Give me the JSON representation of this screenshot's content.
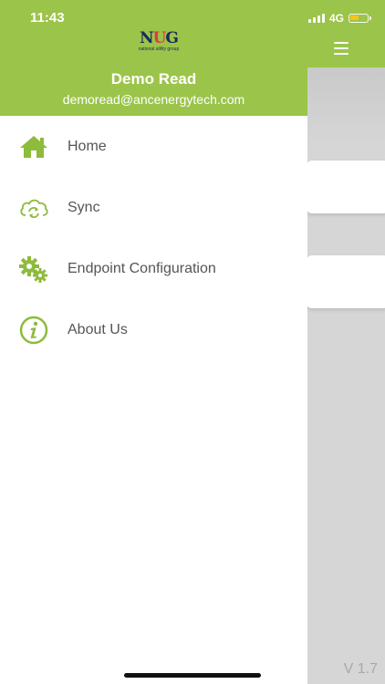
{
  "status_bar": {
    "time": "11:43",
    "network": "4G",
    "battery_level": 0.55
  },
  "drawer": {
    "logo": {
      "text_main": "NUG",
      "text_sub": "national utility group"
    },
    "user_name": "Demo Read",
    "user_email": "demoread@ancenergytech.com",
    "menu": [
      {
        "label": "Home",
        "icon": "home-icon"
      },
      {
        "label": "Sync",
        "icon": "cloud-sync-icon"
      },
      {
        "label": "Endpoint Configuration",
        "icon": "gears-icon"
      },
      {
        "label": "About Us",
        "icon": "info-icon"
      }
    ]
  },
  "version": "V 1.7",
  "colors": {
    "brand_green": "#9bc44a",
    "icon_green": "#8dbb3c",
    "text_gray": "#555555",
    "logo_navy": "#1a2a5c",
    "logo_red": "#e03a3a",
    "battery_yellow": "#f5c518"
  }
}
